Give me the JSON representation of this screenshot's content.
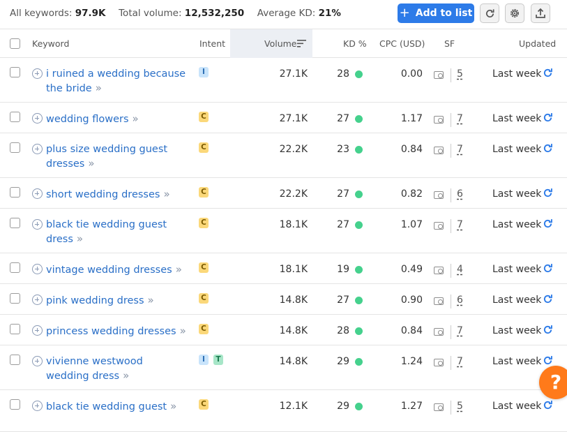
{
  "summary": {
    "keywords_label": "All keywords:",
    "keywords_value": "97.9K",
    "volume_label": "Total volume:",
    "volume_value": "12,532,250",
    "kd_label": "Average KD:",
    "kd_value": "21%"
  },
  "toolbar": {
    "add_label": "Add to list",
    "icons": [
      "refresh-icon",
      "settings-icon",
      "export-icon"
    ]
  },
  "columns": {
    "keyword": "Keyword",
    "intent": "Intent",
    "volume": "Volume",
    "kd": "KD %",
    "cpc": "CPC (USD)",
    "sf": "SF",
    "updated": "Updated"
  },
  "rows": [
    {
      "keyword": "i ruined a wedding because the bride",
      "intent": [
        "I"
      ],
      "volume": "27.1K",
      "kd": "28",
      "cpc": "0.00",
      "sf": "5",
      "updated": "Last week"
    },
    {
      "keyword": "wedding flowers",
      "intent": [
        "C"
      ],
      "volume": "27.1K",
      "kd": "27",
      "cpc": "1.17",
      "sf": "7",
      "updated": "Last week"
    },
    {
      "keyword": "plus size wedding guest dresses",
      "intent": [
        "C"
      ],
      "volume": "22.2K",
      "kd": "23",
      "cpc": "0.84",
      "sf": "7",
      "updated": "Last week"
    },
    {
      "keyword": "short wedding dresses",
      "intent": [
        "C"
      ],
      "volume": "22.2K",
      "kd": "27",
      "cpc": "0.82",
      "sf": "6",
      "updated": "Last week"
    },
    {
      "keyword": "black tie wedding guest dress",
      "intent": [
        "C"
      ],
      "volume": "18.1K",
      "kd": "27",
      "cpc": "1.07",
      "sf": "7",
      "updated": "Last week"
    },
    {
      "keyword": "vintage wedding dresses",
      "intent": [
        "C"
      ],
      "volume": "18.1K",
      "kd": "19",
      "cpc": "0.49",
      "sf": "4",
      "updated": "Last week"
    },
    {
      "keyword": "pink wedding dress",
      "intent": [
        "C"
      ],
      "volume": "14.8K",
      "kd": "27",
      "cpc": "0.90",
      "sf": "6",
      "updated": "Last week"
    },
    {
      "keyword": "princess wedding dresses",
      "intent": [
        "C"
      ],
      "volume": "14.8K",
      "kd": "28",
      "cpc": "0.84",
      "sf": "7",
      "updated": "Last week"
    },
    {
      "keyword": "vivienne westwood wedding dress",
      "intent": [
        "I",
        "T"
      ],
      "volume": "14.8K",
      "kd": "29",
      "cpc": "1.24",
      "sf": "7",
      "updated": "Last week"
    },
    {
      "keyword": "black tie wedding guest",
      "intent": [
        "C"
      ],
      "volume": "12.1K",
      "kd": "29",
      "cpc": "1.27",
      "sf": "5",
      "updated": "Last week"
    }
  ],
  "help_label": "?",
  "colors": {
    "accent": "#2d7be8",
    "link": "#2a6fc7",
    "kd_dot": "#45d18d",
    "help": "#ff7a1a"
  }
}
